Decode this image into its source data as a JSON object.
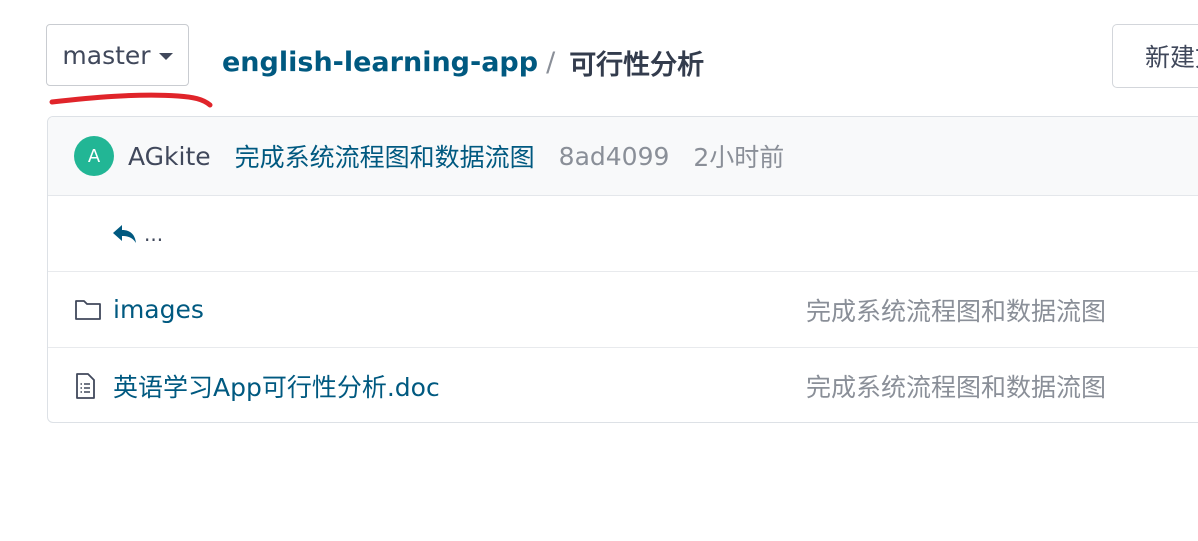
{
  "branch": {
    "label": "master",
    "icon": "caret-down-icon"
  },
  "annotation": {
    "color": "#e0242a"
  },
  "breadcrumb": {
    "repo": "english-learning-app",
    "separator": "/",
    "current": "可行性分析"
  },
  "toolbar": {
    "new_file_label": "新建文件",
    "new_file_icon": "file-plus-icon"
  },
  "commit": {
    "avatar_initial": "A",
    "avatar_color": "#22b695",
    "author": "AGkite",
    "message": "完成系统流程图和数据流图",
    "sha": "8ad4099",
    "time": "2小时前"
  },
  "tree": {
    "back": {
      "icon": "reply-arrow-icon",
      "label": "..."
    },
    "files": [
      {
        "type": "folder",
        "icon": "folder-icon",
        "name": "images",
        "commit": "完成系统流程图和数据流图"
      },
      {
        "type": "file",
        "icon": "document-icon",
        "name": "英语学习App可行性分析.doc",
        "commit": "完成系统流程图和数据流图"
      }
    ]
  },
  "colors": {
    "link": "#005980",
    "muted": "#8a8f98",
    "text": "#40485b"
  }
}
